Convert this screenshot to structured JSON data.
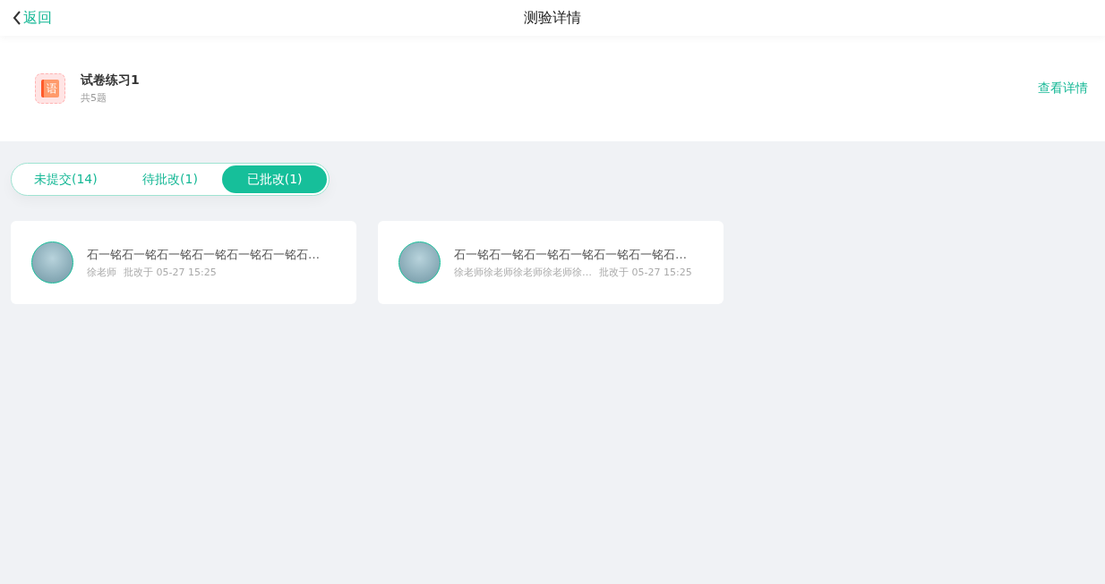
{
  "header": {
    "back": "返回",
    "title": "测验详情"
  },
  "exam": {
    "icon_char": "语",
    "name": "试卷练习1",
    "count": "共5题",
    "details_link": "查看详情"
  },
  "tabs": [
    {
      "label": "未提交(14)",
      "selected": false
    },
    {
      "label": "待批改(1)",
      "selected": false
    },
    {
      "label": "已批改(1)",
      "selected": true
    }
  ],
  "records": [
    {
      "title": "石一铭石一铭石一铭石一铭石一铭石一铭石…",
      "teacher": "徐老师",
      "time": "批改于 05-27 15:25"
    },
    {
      "title": "石一铭石一铭石一铭石一铭石一铭石一铭石…",
      "teacher": "徐老师徐老师徐老师徐老师徐…",
      "time": "批改于 05-27 15:25"
    }
  ]
}
